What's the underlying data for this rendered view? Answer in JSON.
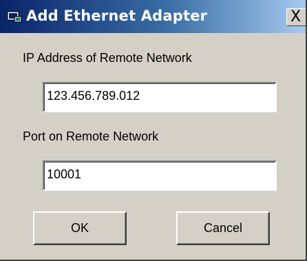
{
  "window": {
    "title": "Add Ethernet Adapter",
    "close_glyph": "X",
    "icon": "network-adapter-icon"
  },
  "form": {
    "ip_label": "IP Address of Remote Network",
    "ip_value": "123.456.789.012",
    "port_label": "Port on Remote Network",
    "port_value": "10001"
  },
  "buttons": {
    "ok_label": "OK",
    "cancel_label": "Cancel"
  },
  "colors": {
    "title_gradient_start": "#0a246a",
    "title_gradient_end": "#a6caf0",
    "dialog_face": "#d4d0c8"
  }
}
